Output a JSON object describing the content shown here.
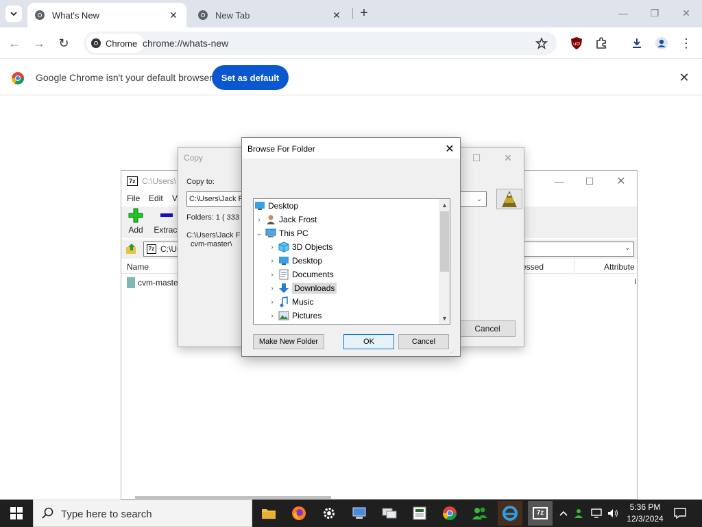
{
  "chrome": {
    "tabs": [
      {
        "title": "What's New",
        "active": true
      },
      {
        "title": "New Tab",
        "active": false
      }
    ],
    "chip_label": "Chrome",
    "url": "chrome://whats-new",
    "infobar": {
      "message": "Google Chrome isn't your default browser",
      "button_label": "Set as default"
    }
  },
  "sevenzip": {
    "title": "C:\\Users\\",
    "menu": [
      "File",
      "Edit",
      "Vi"
    ],
    "toolbar": [
      {
        "label": "Add",
        "icon": "plus-icon"
      },
      {
        "label": "Extract",
        "icon": "minus-icon"
      }
    ],
    "address": "C:\\Us",
    "columns": [
      "Name",
      "essed",
      "Attribute"
    ],
    "rows": [
      {
        "name": "cvm-maste"
      }
    ],
    "attr_partial": "I"
  },
  "copy_dialog": {
    "title": "Copy",
    "copy_to_label": "Copy to:",
    "path_value": "C:\\Users\\Jack F",
    "folders_info": "Folders: 1    ( 333",
    "source_line1": "C:\\Users\\Jack F",
    "source_line2": "cvm-master\\",
    "cancel_label": "Cancel"
  },
  "browse_dialog": {
    "title": "Browse For Folder",
    "tree": [
      {
        "label": "Desktop",
        "icon": "desktop-folder-icon",
        "expander": "",
        "level": 0
      },
      {
        "label": "Jack Frost",
        "icon": "user-icon",
        "expander": ">",
        "level": 0
      },
      {
        "label": "This PC",
        "icon": "computer-icon",
        "expander": "v",
        "level": 0
      },
      {
        "label": "3D Objects",
        "icon": "3d-objects-icon",
        "expander": ">",
        "level": 1
      },
      {
        "label": "Desktop",
        "icon": "desktop-folder-icon",
        "expander": ">",
        "level": 1
      },
      {
        "label": "Documents",
        "icon": "documents-icon",
        "expander": ">",
        "level": 1
      },
      {
        "label": "Downloads",
        "icon": "downloads-icon",
        "expander": ">",
        "level": 1,
        "selected": true
      },
      {
        "label": "Music",
        "icon": "music-icon",
        "expander": ">",
        "level": 1
      },
      {
        "label": "Pictures",
        "icon": "pictures-icon",
        "expander": ">",
        "level": 1
      }
    ],
    "buttons": {
      "make_new_folder": "Make New Folder",
      "ok": "OK",
      "cancel": "Cancel"
    }
  },
  "taskbar": {
    "search_placeholder": "Type here to search",
    "apps": [
      "file-explorer-icon",
      "firefox-icon",
      "settings-icon",
      "network-app-icon",
      "remote-desktop-icon",
      "sheet-app-icon",
      "chrome-icon",
      "people-icon",
      "edge-icon",
      "sevenzip-icon"
    ],
    "time": "5:36 PM",
    "date": "12/3/2024"
  },
  "colors": {
    "accent_blue": "#0b57d0",
    "tabstrip_bg": "#dfe3eb",
    "taskbar_bg": "#1f1f1f",
    "selected_tree_bg": "#d9d9d9"
  }
}
